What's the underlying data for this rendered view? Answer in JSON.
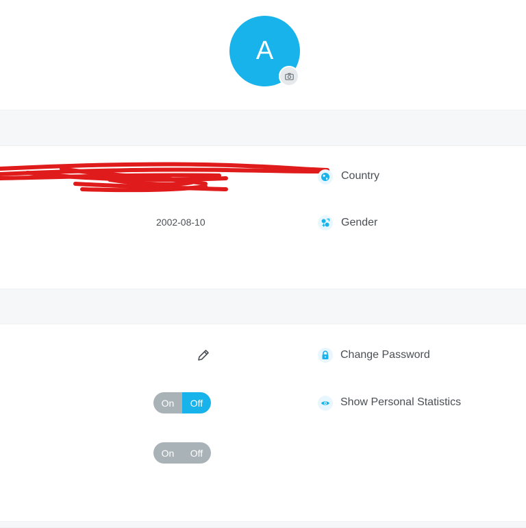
{
  "profile": {
    "avatar_initial": "A"
  },
  "personal_info": {
    "country_label": "Country",
    "birthdate_value": "2002-08-10",
    "gender_label": "Gender"
  },
  "security": {
    "change_password_label": "Change Password",
    "show_stats_label": "Show Personal Statistics"
  },
  "toggles": [
    {
      "on_label": "On",
      "off_label": "Off",
      "state": "off",
      "active_color": "#17b3ea"
    },
    {
      "on_label": "On",
      "off_label": "Off",
      "state": "neutral"
    }
  ],
  "colors": {
    "accent": "#17b3ea",
    "band": "#f5f7f8",
    "toggle_gray": "#a9b2b7",
    "redaction": "#e01b1b"
  },
  "icons": {
    "country": "globe-icon",
    "gender": "gender-icon",
    "password": "lock-icon",
    "stats": "eye-icon",
    "edit": "pencil-icon",
    "avatar": "camera-icon"
  }
}
